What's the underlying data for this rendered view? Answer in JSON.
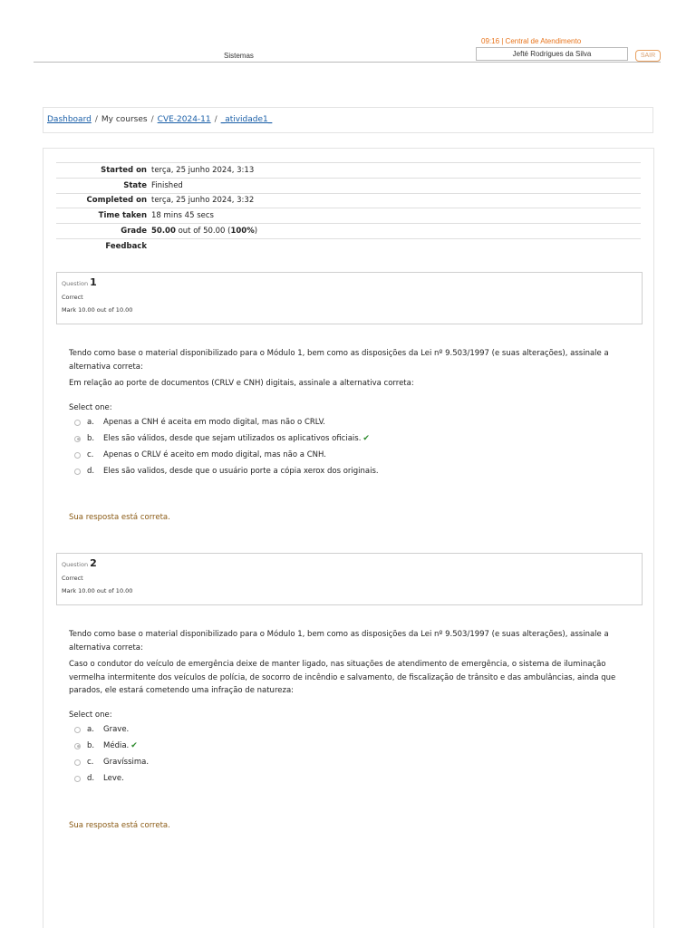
{
  "header": {
    "clock_line": "09:16 | Central de Atendimento",
    "sistemas": "Sistemas",
    "user_name": "Jefté Rodrigues da Silva",
    "logout_label": "SAIR"
  },
  "breadcrumb": {
    "dashboard": "Dashboard",
    "my_courses": "My courses",
    "course": "CVE-2024-11",
    "activity": "_atividade1_",
    "separator": "/"
  },
  "summary": {
    "started_label": "Started on",
    "started_value": "terça, 25 junho 2024, 3:13",
    "state_label": "State",
    "state_value": "Finished",
    "completed_label": "Completed on",
    "completed_value": "terça, 25 junho 2024, 3:32",
    "time_label": "Time taken",
    "time_value": "18 mins 45 secs",
    "grade_label": "Grade",
    "grade_score": "50.00",
    "grade_rest": " out of 50.00 (",
    "grade_percent": "100%",
    "grade_close": ")",
    "feedback_label": "Feedback"
  },
  "questions": [
    {
      "label": "Question",
      "number": "1",
      "status": "Correct",
      "mark": "Mark 10.00 out of 10.00",
      "intro": "Tendo como base o material disponibilizado para o Módulo 1, bem como as disposições da Lei nº 9.503/1997 (e suas alterações), assinale a alternativa correta:",
      "text": "Em relação ao porte de documentos (CRLV e CNH) digitais, assinale a alternativa correta:",
      "select_label": "Select one:",
      "answers": [
        {
          "letter": "a.",
          "text": "Apenas a CNH é aceita em modo digital, mas não o CRLV."
        },
        {
          "letter": "b.",
          "text": "Eles são válidos, desde que sejam utilizados os aplicativos oficiais."
        },
        {
          "letter": "c.",
          "text": "Apenas o CRLV é aceito em modo digital, mas não a CNH."
        },
        {
          "letter": "d.",
          "text": "Eles são validos, desde que o usuário porte a cópia xerox dos originais."
        }
      ],
      "selected": "b",
      "feedback": "Sua resposta está correta."
    },
    {
      "label": "Question",
      "number": "2",
      "status": "Correct",
      "mark": "Mark 10.00 out of 10.00",
      "intro": "Tendo como base o material disponibilizado para o Módulo 1, bem como as disposições da Lei nº 9.503/1997 (e suas alterações), assinale a alternativa correta:",
      "text": "Caso o condutor do veículo de emergência deixe de manter ligado, nas situações de atendimento de emergência, o sistema de iluminação vermelha intermitente dos veículos de polícia, de socorro de incêndio e salvamento, de fiscalização de trânsito e das ambulâncias, ainda que parados, ele estará cometendo uma infração de natureza:",
      "select_label": "Select one:",
      "answers": [
        {
          "letter": "a.",
          "text": "Grave."
        },
        {
          "letter": "b.",
          "text": "Média."
        },
        {
          "letter": "c.",
          "text": "Gravíssima."
        },
        {
          "letter": "d.",
          "text": "Leve."
        }
      ],
      "selected": "b",
      "feedback": "Sua resposta está correta."
    }
  ],
  "icons": {
    "correct_tick": "check-icon",
    "tick_color": "#2e8b2e",
    "accent": "#e8731a"
  }
}
